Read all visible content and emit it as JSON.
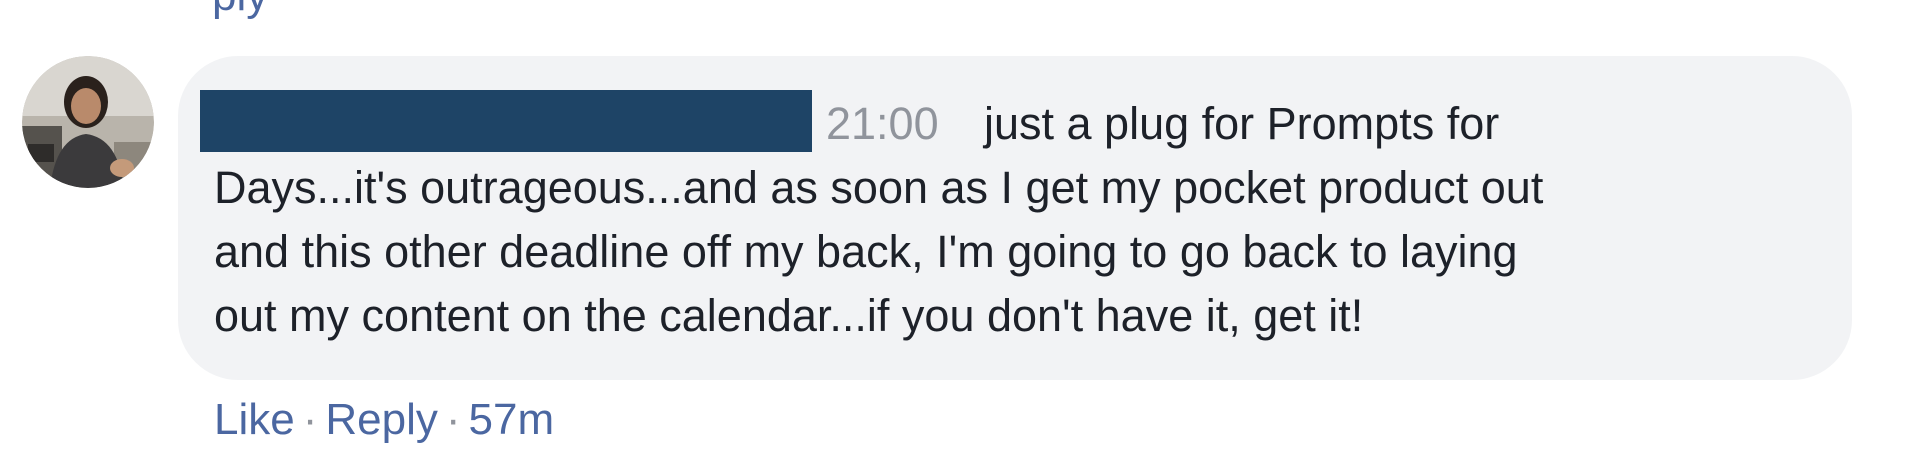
{
  "previous_comment": {
    "reply_link_fragment": "ply"
  },
  "comment": {
    "author_name_redacted": true,
    "timestamp_tag": "21:00",
    "text_lines": [
      "just a plug for Prompts for",
      "Days...it's outrageous...and as soon as I get my pocket product out",
      "and this other deadline off my back, I'm going to go back to laying",
      "out my content on the calendar...if you don't have it, get it!"
    ],
    "actions": {
      "like_label": "Like",
      "separator": "·",
      "reply_label": "Reply",
      "age": "57m"
    }
  },
  "colors": {
    "bubble_bg": "#f2f3f5",
    "link": "#4b67a1",
    "text": "#1d2129",
    "muted": "#90949c",
    "redaction": "#1e4466"
  }
}
